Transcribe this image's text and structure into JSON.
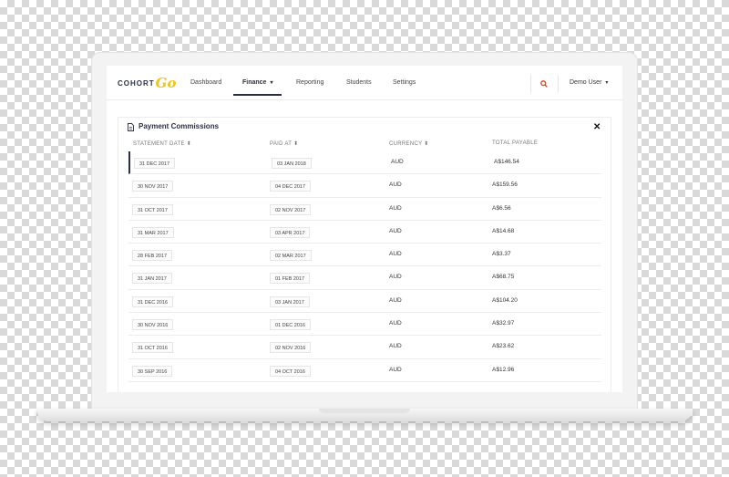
{
  "nav": {
    "logo_text": "COHORT",
    "logo_script": "Go",
    "items": [
      {
        "label": "Dashboard"
      },
      {
        "label": "Finance",
        "chevron": "▾"
      },
      {
        "label": "Reporting"
      },
      {
        "label": "Students"
      },
      {
        "label": "Settings"
      }
    ],
    "user": "Demo User",
    "user_chevron": "▾"
  },
  "panel": {
    "title": "Payment Commissions",
    "close": "✕",
    "columns": [
      "STATEMENT DATE ⬍",
      "PAID AT ⬍",
      "CURRENCY ⬍",
      "TOTAL PAYABLE"
    ]
  },
  "rows": [
    {
      "statement": "31 DEC 2017",
      "paid": "03 JAN 2018",
      "currency": "AUD",
      "total": "A$146.54"
    },
    {
      "statement": "30 NOV 2017",
      "paid": "04 DEC 2017",
      "currency": "AUD",
      "total": "A$159.56"
    },
    {
      "statement": "31 OCT 2017",
      "paid": "02 NOV 2017",
      "currency": "AUD",
      "total": "A$6.56"
    },
    {
      "statement": "31 MAR 2017",
      "paid": "03 APR 2017",
      "currency": "AUD",
      "total": "A$14.68"
    },
    {
      "statement": "28 FEB 2017",
      "paid": "02 MAR 2017",
      "currency": "AUD",
      "total": "A$3.37"
    },
    {
      "statement": "31 JAN 2017",
      "paid": "01 FEB 2017",
      "currency": "AUD",
      "total": "A$68.75"
    },
    {
      "statement": "31 DEC 2016",
      "paid": "03 JAN 2017",
      "currency": "AUD",
      "total": "A$104.20"
    },
    {
      "statement": "30 NOV 2016",
      "paid": "01 DEC 2016",
      "currency": "AUD",
      "total": "A$32.97"
    },
    {
      "statement": "31 OCT 2016",
      "paid": "02 NOV 2016",
      "currency": "AUD",
      "total": "A$23.62"
    },
    {
      "statement": "30 SEP 2016",
      "paid": "04 OCT 2016",
      "currency": "AUD",
      "total": "A$12.96"
    }
  ],
  "colors": {
    "accent": "#2a2f45",
    "logo_yellow": "#f2c318",
    "search_red": "#d9401f"
  }
}
